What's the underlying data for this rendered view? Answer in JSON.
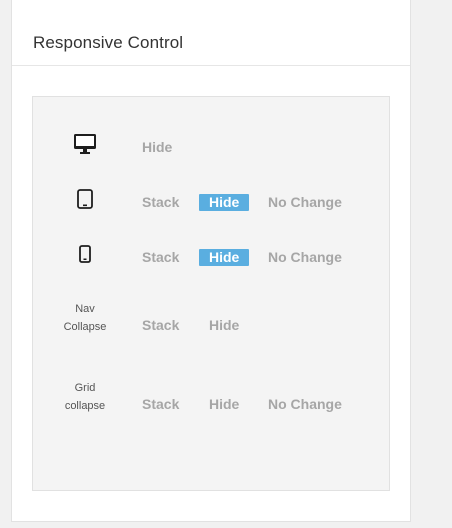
{
  "panel": {
    "title": "Responsive Control"
  },
  "rows": [
    {
      "device": "desktop",
      "icon": "desktop-icon",
      "options": {
        "hide": "Hide"
      },
      "active": null
    },
    {
      "device": "tablet",
      "icon": "tablet-icon",
      "options": {
        "stack": "Stack",
        "hide": "Hide",
        "no_change": "No Change"
      },
      "active": "hide"
    },
    {
      "device": "phone",
      "icon": "phone-icon",
      "options": {
        "stack": "Stack",
        "hide": "Hide",
        "no_change": "No Change"
      },
      "active": "hide"
    },
    {
      "device": "nav-collapse",
      "label_line1": "Nav",
      "label_line2": "Collapse",
      "options": {
        "stack": "Stack",
        "hide": "Hide"
      },
      "active": null
    },
    {
      "device": "grid-collapse",
      "label_line1": "Grid",
      "label_line2": "collapse",
      "options": {
        "stack": "Stack",
        "hide": "Hide",
        "no_change": "No Change"
      },
      "active": null
    }
  ],
  "colors": {
    "active_bg": "#5aaee0",
    "inactive_text": "#a6a6a6",
    "box_bg": "#f4f4f4"
  }
}
